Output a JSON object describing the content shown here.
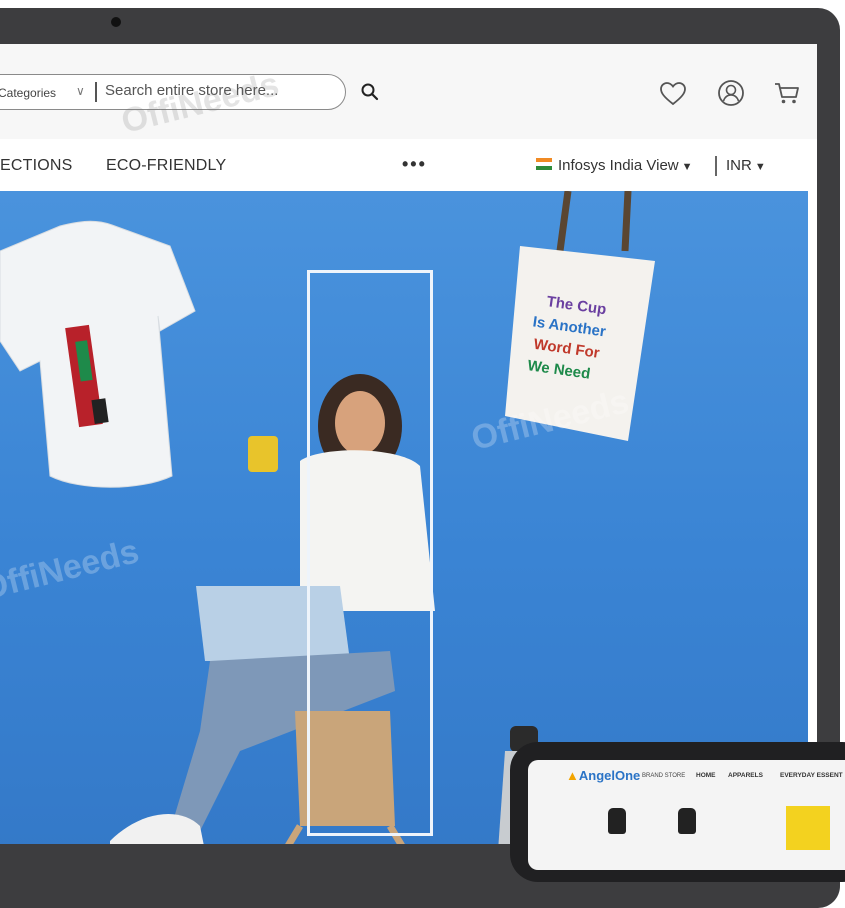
{
  "header": {
    "categories_label": "Categories",
    "search_placeholder": "Search entire store here...",
    "icons": [
      "search-icon",
      "heart-icon",
      "user-icon",
      "cart-icon"
    ]
  },
  "nav": {
    "items": [
      "ECTIONS",
      "ECO-FRIENDLY"
    ],
    "more": "•••",
    "view_label": "Infosys India View",
    "currency": "INR"
  },
  "hero": {
    "watermark": "OffiNeeds",
    "tote_text": [
      "The Cup",
      "Is Another",
      "Word For",
      "We Need"
    ]
  },
  "tablet": {
    "logo": "AngelOne",
    "logo_sub": "BRAND STORE",
    "nav": [
      "HOME",
      "APPARELS",
      "EVERYDAY ESSENT"
    ]
  },
  "colors": {
    "hero_blue": "#3a84d4",
    "bezel": "#3d3d3f",
    "tablet_brand": "#2a73c6",
    "tablet_accent": "#f3d21f"
  }
}
